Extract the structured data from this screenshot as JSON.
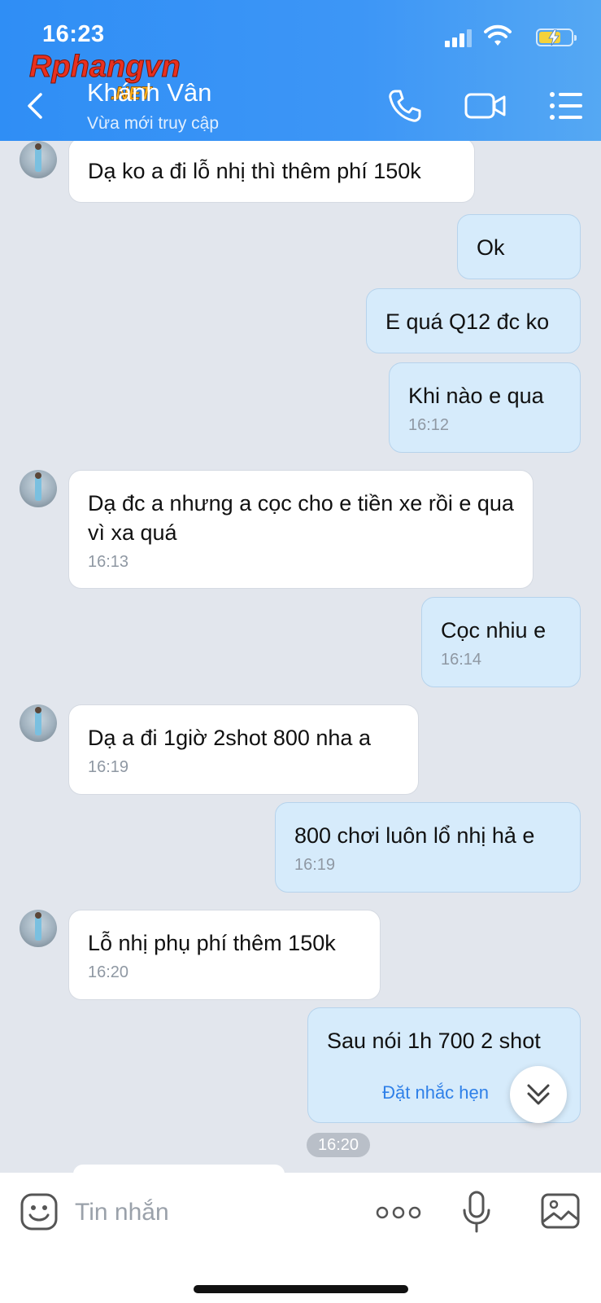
{
  "status_bar": {
    "time": "16:23"
  },
  "watermark": {
    "text": "Rphangvn",
    "suffix": ".NET"
  },
  "header": {
    "contact_name": "Khánh Vân",
    "contact_status": "Vừa mới truy cập",
    "icons": [
      "back-arrow-icon",
      "phone-icon",
      "video-camera-icon",
      "menu-list-icon"
    ]
  },
  "messages": [
    {
      "side": "in",
      "text": "Dạ ko a đi lỗ nhị thì thêm phí 150k",
      "time": ""
    },
    {
      "side": "out",
      "text": "Ok",
      "time": ""
    },
    {
      "side": "out",
      "text": "E quá Q12 đc ko",
      "time": ""
    },
    {
      "side": "out",
      "text": "Khi nào e qua",
      "time": "16:12"
    },
    {
      "side": "in",
      "text": "Dạ đc a nhưng a cọc cho e tiền xe rồi e qua vì xa quá",
      "time": "16:13"
    },
    {
      "side": "out",
      "text": "Cọc nhiu e",
      "time": "16:14"
    },
    {
      "side": "in",
      "text": "Dạ a đi 1giờ 2shot 800 nha a",
      "time": "16:19"
    },
    {
      "side": "out",
      "text": "800 chơi luôn lổ nhị hả e",
      "time": "16:19"
    },
    {
      "side": "in",
      "text": "Lỗ nhị phụ phí thêm 150k",
      "time": "16:20"
    },
    {
      "side": "out",
      "text": "Sau nói 1h 700 2 shot",
      "time": "",
      "action": "Đặt nhắc hẹn"
    }
  ],
  "time_divider": "16:20",
  "input": {
    "placeholder": "Tin nhắn"
  },
  "colors": {
    "header": "#3d96f6",
    "outgoing_bubble": "#d6ebfb",
    "incoming_bubble": "#ffffff",
    "chat_bg": "#e2e6ed",
    "link": "#2f80e8"
  }
}
